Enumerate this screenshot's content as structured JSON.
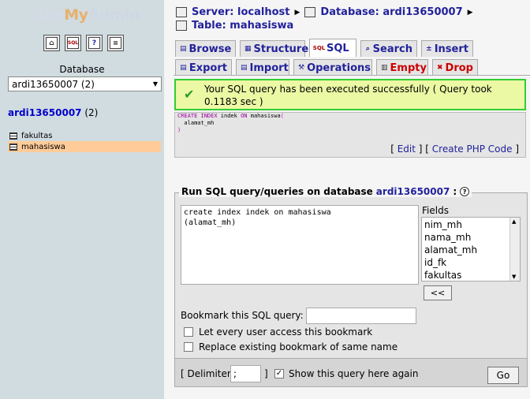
{
  "logo": {
    "php": "php",
    "my": "My",
    "admin": "Admin"
  },
  "nav_icons": [
    "home-icon",
    "sql-icon",
    "help-icon",
    "docs-icon"
  ],
  "nav_icon_text": {
    "sql": "SQL"
  },
  "sidebar": {
    "database_label": "Database",
    "selected_db": "ardi13650007 (2)",
    "db_name": "ardi13650007",
    "db_count": " (2)",
    "tables": [
      {
        "label": "fakultas",
        "active": false
      },
      {
        "label": "mahasiswa",
        "active": true
      }
    ]
  },
  "breadcrumb": {
    "server_label": "Server: localhost",
    "database_label": "Database: ardi13650007",
    "table_label": "Table: mahasiswa"
  },
  "tabs_row1": [
    "Browse",
    "Structure",
    "SQL",
    "Search",
    "Insert"
  ],
  "tabs_row2": [
    "Export",
    "Import",
    "Operations",
    "Empty",
    "Drop"
  ],
  "active_tab": "SQL",
  "message": {
    "text": "Your SQL query has been executed successfully ( Query took 0.1183 sec )"
  },
  "executed_sql": {
    "line1_kw1": "CREATE INDEX",
    "line1_mid": " indek ",
    "line1_kw2": "ON",
    "line1_rest": " mahasiswa",
    "line1_par": "(",
    "line2": "  alamat_mh",
    "line3": ")"
  },
  "sql_links": {
    "edit": "Edit",
    "create_php": "Create PHP Code"
  },
  "query_form": {
    "legend": "Run SQL query/queries on database",
    "db_name": "ardi13650007",
    "legend_suffix": ":",
    "query_text": "create index indek on mahasiswa\n(alamat_mh)",
    "fields_label": "Fields",
    "fields": [
      "nim_mh",
      "nama_mh",
      "alamat_mh",
      "id_fk",
      "fakultas"
    ],
    "insert_button": "<<",
    "bookmark_label": "Bookmark this SQL query:",
    "bookmark_value": "",
    "checkbox_every_user": "Let every user access this bookmark",
    "checkbox_replace": "Replace existing bookmark of same name",
    "delimiter_label": "[ Delimiter",
    "delimiter_value": ";",
    "delimiter_close": "]",
    "show_again_label": "Show this query here again",
    "show_again_checked": true,
    "go_button": "Go"
  },
  "colors": {
    "success_border": "#33cc33",
    "success_bg": "#ebf8a4",
    "link": "#22229b",
    "active_table_bg": "#ffcc99"
  }
}
